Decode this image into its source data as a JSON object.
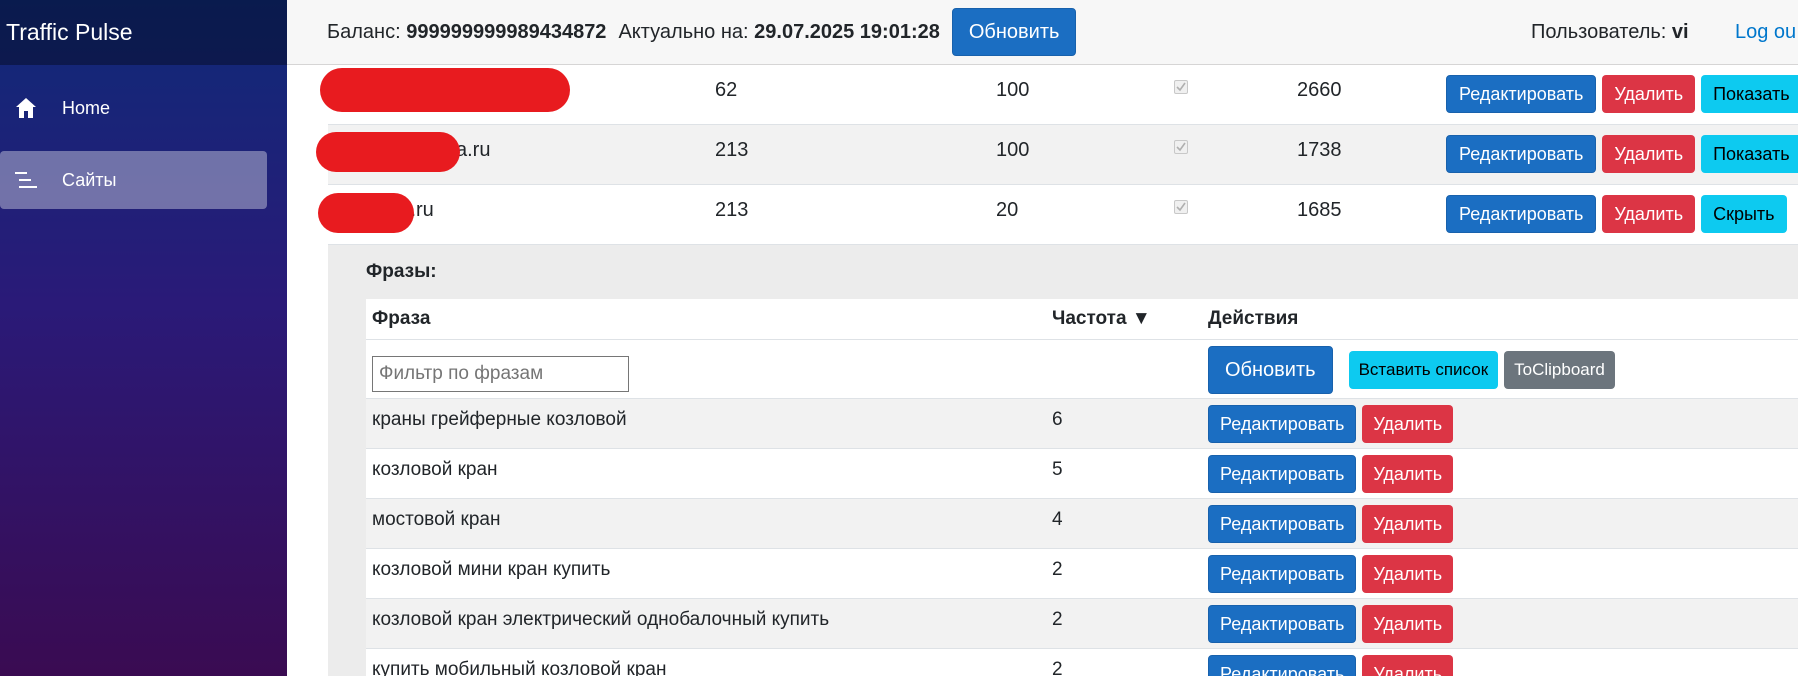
{
  "app": {
    "brand": "Traffic Pulse"
  },
  "sidebar": {
    "items": [
      {
        "label": "Home",
        "icon": "home-icon",
        "active": false
      },
      {
        "label": "Сайты",
        "icon": "list-icon",
        "active": true
      }
    ]
  },
  "topbar": {
    "balance_label": "Баланс:",
    "balance_value": "999999999989434872",
    "actual_label": "Актуально на:",
    "actual_value": "29.07.2025 19:01:28",
    "refresh_label": "Обновить",
    "user_label": "Пользователь:",
    "user_value": "vi",
    "logout_label": "Log ou"
  },
  "sites": {
    "rows": [
      {
        "name": "",
        "region": "62",
        "limit": "100",
        "count": "2660",
        "edit": "Редактировать",
        "delete": "Удалить",
        "toggle": "Показать"
      },
      {
        "name": "a.ru",
        "region": "213",
        "limit": "100",
        "count": "1738",
        "edit": "Редактировать",
        "delete": "Удалить",
        "toggle": "Показать"
      },
      {
        "name": "l.ru",
        "region": "213",
        "limit": "20",
        "count": "1685",
        "edit": "Редактировать",
        "delete": "Удалить",
        "toggle": "Скрыть"
      }
    ]
  },
  "phrases": {
    "title": "Фразы:",
    "headers": {
      "phrase": "Фраза",
      "frequency": "Частота ▼",
      "actions": "Действия"
    },
    "filter_placeholder": "Фильтр по фразам",
    "refresh_label": "Обновить",
    "paste_label": "Вставить список",
    "clipboard_label": "ToClipboard",
    "edit_label": "Редактировать",
    "delete_label": "Удалить",
    "rows": [
      {
        "phrase": "краны грейферные козловой",
        "frequency": "6"
      },
      {
        "phrase": "козловой кран",
        "frequency": "5"
      },
      {
        "phrase": "мостовой кран",
        "frequency": "4"
      },
      {
        "phrase": "козловой мини кран купить",
        "frequency": "2"
      },
      {
        "phrase": "козловой кран электрический однобалочный купить",
        "frequency": "2"
      },
      {
        "phrase": "купить мобильный козловой кран",
        "frequency": "2"
      }
    ]
  },
  "colors": {
    "primary": "#1b6ec2",
    "danger": "#dc3545",
    "info": "#0dcaf0",
    "secondary": "#6c757d",
    "redaction": "#e81b1f"
  }
}
